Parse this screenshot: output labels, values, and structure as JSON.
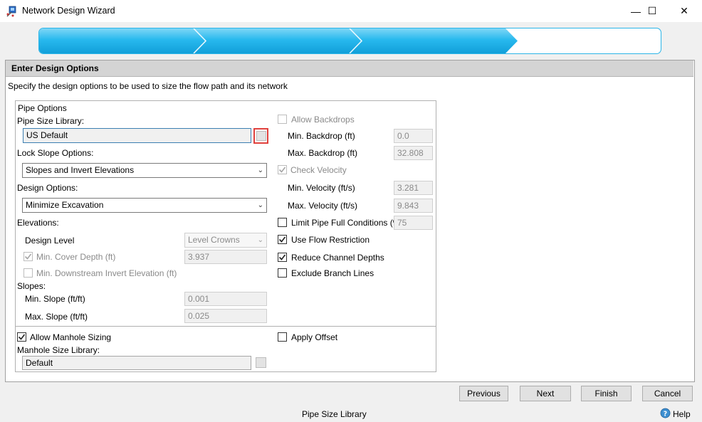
{
  "window": {
    "title": "Network Design Wizard",
    "controls": {
      "minimize": "—",
      "maximize": "☐",
      "close": "✕"
    },
    "icon": "network-wizard-icon"
  },
  "progress": {
    "total_steps": 4,
    "completed_steps": 3,
    "accent": "#1cb3e9"
  },
  "section": {
    "title": "Enter Design Options",
    "description": "Specify the design options to be used to size the flow path and its network"
  },
  "pipe_options": {
    "group_label": "Pipe Options",
    "size_library_label": "Pipe Size Library:",
    "size_library_value": "US Default",
    "lock_slope_label": "Lock Slope Options:",
    "lock_slope_value": "Slopes and Invert Elevations",
    "design_options_label": "Design Options:",
    "design_options_value": "Minimize Excavation",
    "elevations_label": "Elevations:",
    "design_level_label": "Design Level",
    "design_level_value": "Level Crowns",
    "min_cover_label": "Min. Cover Depth (ft)",
    "min_cover_value": "3.937",
    "min_downstream_label": "Min. Downstream Invert Elevation (ft)",
    "slopes_label": "Slopes:",
    "min_slope_label": "Min. Slope (ft/ft)",
    "min_slope_value": "0.001",
    "max_slope_label": "Max. Slope (ft/ft)",
    "max_slope_value": "0.025"
  },
  "right_options": {
    "allow_backdrops_label": "Allow Backdrops",
    "min_backdrop_label": "Min. Backdrop (ft)",
    "min_backdrop_value": "0.0",
    "max_backdrop_label": "Max. Backdrop (ft)",
    "max_backdrop_value": "32.808",
    "check_velocity_label": "Check Velocity",
    "min_velocity_label": "Min. Velocity (ft/s)",
    "min_velocity_value": "3.281",
    "max_velocity_label": "Max. Velocity (ft/s)",
    "max_velocity_value": "9.843",
    "limit_full_label": "Limit Pipe Full Conditions (%)",
    "limit_full_value": "75",
    "use_flow_label": "Use Flow Restriction",
    "reduce_channel_label": "Reduce Channel Depths",
    "exclude_branch_label": "Exclude Branch Lines"
  },
  "manhole": {
    "allow_sizing_label": "Allow Manhole Sizing",
    "apply_offset_label": "Apply Offset",
    "library_label": "Manhole Size Library:",
    "library_value": "Default"
  },
  "buttons": {
    "previous": "Previous",
    "next": "Next",
    "finish": "Finish",
    "cancel": "Cancel"
  },
  "status": {
    "text": "Pipe Size Library",
    "help_label": "Help",
    "help_icon": "help-question-icon"
  }
}
